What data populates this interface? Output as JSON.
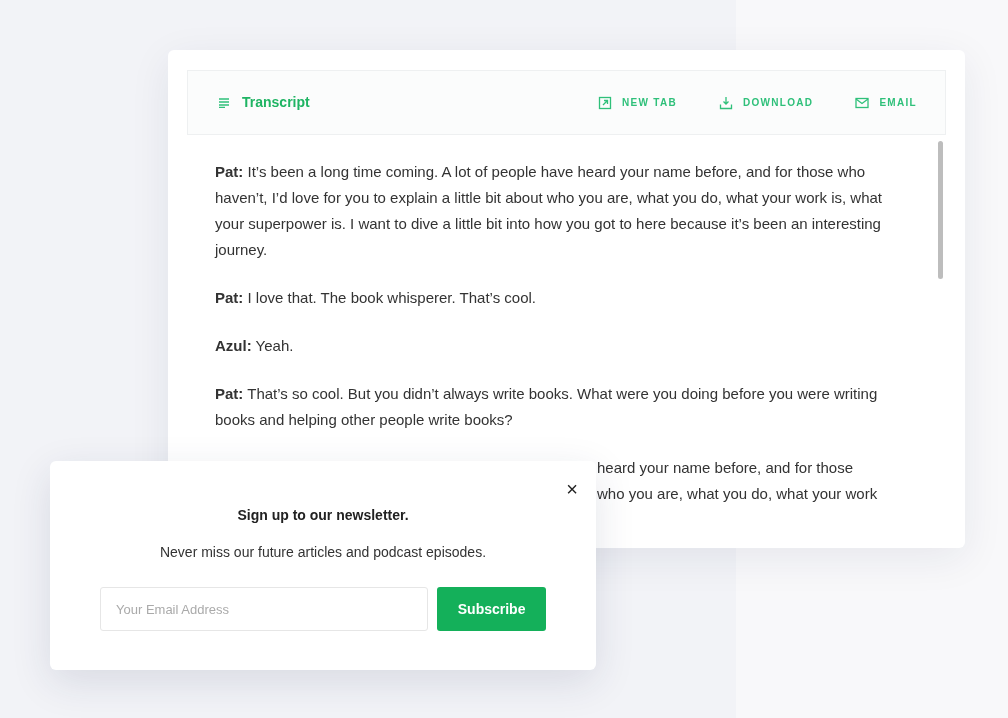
{
  "transcript": {
    "title": "Transcript",
    "actions": [
      {
        "label": "NEW TAB",
        "kind": "newtab"
      },
      {
        "label": "DOWNLOAD",
        "kind": "download"
      },
      {
        "label": "EMAIL",
        "kind": "email"
      }
    ],
    "paragraphs": [
      "**Pat:** It’s been a long time coming. A lot of people have heard your name before, and for those who haven’t, I’d love for you to explain a little bit about who you are, what you do, what your work is, what your superpower is. I want to dive a little bit into how you got to here because it’s been an interesting journey.",
      "**Pat:** I love that. The book whisperer. That’s cool.",
      "**Azul:** Yeah.",
      "**Pat:** That’s so cool. But you didn’t always write books. What were you doing before you were writing books and helping other people write books?"
    ],
    "partial_lines": [
      "heard your name before, and for those",
      "who you are, what you do, what your work"
    ]
  },
  "newsletter": {
    "close": "×",
    "title": "Sign up to our newsletter.",
    "subtitle": "Never miss our future articles and podcast episodes.",
    "email": {
      "placeholder": "Your Email Address"
    },
    "button": "Subscribe"
  }
}
